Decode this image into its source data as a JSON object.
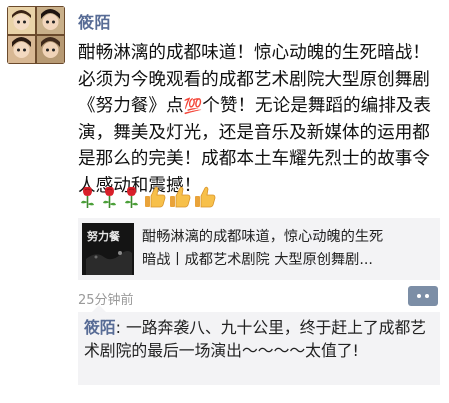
{
  "post": {
    "author": "筱陌",
    "text_before_icon": "酣畅淋漓的成都味道！惊心动魄的生死暗战！必须为今晚观看的成都艺术剧院大型原创舞剧《努力餐》点",
    "icon_100": "💯",
    "text_after_icon": "个赞！无论是舞蹈的编排及表演，舞美及灯光，还是音乐及新媒体的运用都是那么的完美！成都本土车耀先烈士的故事令人感动和震撼！",
    "emojis": [
      "rose-icon",
      "rose-icon",
      "rose-icon",
      "thumbs-up-icon",
      "thumbs-up-icon",
      "thumbs-up-icon"
    ],
    "time": "25分钟前"
  },
  "shared_link": {
    "line1": "酣畅淋漓的成都味道，惊心动魄的生死",
    "line2": "暗战丨成都艺术剧院 大型原创舞剧...",
    "thumb_title": "努力餐"
  },
  "comment": {
    "author": "筱陌",
    "separator": ": ",
    "text": "一路奔袭八、九十公里，终于赶上了成都艺术剧院的最后一场演出～～～～太值了!"
  },
  "colors": {
    "name": "#576b95",
    "card_bg": "#f3f3f5",
    "timestamp": "#9a9a9a",
    "comment_button": "#7c8ea6"
  }
}
